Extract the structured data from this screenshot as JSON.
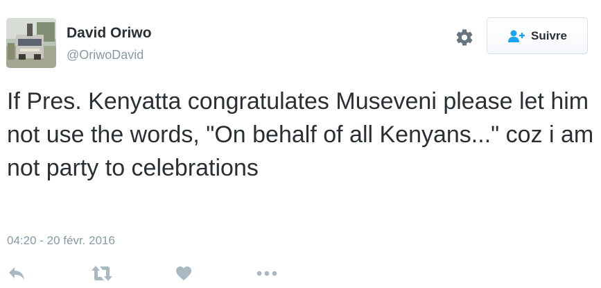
{
  "author": {
    "display_name": "David Oriwo",
    "screen_name": "@OriwoDavid"
  },
  "follow_button": {
    "label": "Suivre",
    "icon": "add-user-icon"
  },
  "settings_icon": "gear-icon",
  "tweet": {
    "text": "If Pres. Kenyatta congratulates Museveni please let him not use the words, \"On behalf of all Kenyans...\" coz i am not party to celebrations",
    "timestamp": "04:20 - 20 févr. 2016"
  },
  "actions": [
    {
      "name": "reply",
      "icon": "reply-icon"
    },
    {
      "name": "retweet",
      "icon": "retweet-icon"
    },
    {
      "name": "like",
      "icon": "heart-icon"
    },
    {
      "name": "more",
      "icon": "more-dots-icon"
    }
  ],
  "colors": {
    "text": "#292f33",
    "secondary": "#8899a6",
    "action_icons": "#aab8c2",
    "follow_icon": "#1da1f2",
    "gear": "#66757f"
  }
}
